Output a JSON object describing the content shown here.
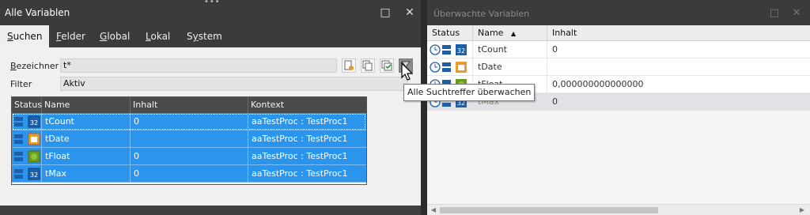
{
  "left_window": {
    "title": "Alle Variablen",
    "maximize_glyph": "□",
    "close_glyph": "✕",
    "grip_glyph": "•••",
    "tabs": [
      {
        "prefix": "",
        "accel": "S",
        "rest": "uchen"
      },
      {
        "prefix": "",
        "accel": "F",
        "rest": "elder"
      },
      {
        "prefix": "",
        "accel": "G",
        "rest": "lobal"
      },
      {
        "prefix": "",
        "accel": "L",
        "rest": "okal"
      },
      {
        "prefix": "S",
        "accel": "y",
        "rest": "stem"
      }
    ],
    "bezeichner_label": {
      "accel": "B",
      "rest": "ezeichner"
    },
    "bezeichner_value": "t*",
    "filter_label": "Filter",
    "filter_value": "Aktiv",
    "toolbar_icons": [
      "new-document-icon",
      "copy-icon",
      "check-all-icon",
      "watch-all-icon"
    ],
    "columns": [
      "Status",
      "Name",
      "Inhalt",
      "Kontext"
    ],
    "rows": [
      {
        "status": [
          "variable-icon",
          "int-type-icon"
        ],
        "name": "tCount",
        "inhalt": "0",
        "kontext": "aaTestProc : TestProc1"
      },
      {
        "status": [
          "variable-icon",
          "date-type-icon"
        ],
        "name": "tDate",
        "inhalt": "",
        "kontext": "aaTestProc : TestProc1"
      },
      {
        "status": [
          "variable-icon",
          "float-type-icon"
        ],
        "name": "tFloat",
        "inhalt": "0",
        "kontext": "aaTestProc : TestProc1"
      },
      {
        "status": [
          "variable-icon",
          "int-type-icon"
        ],
        "name": "tMax",
        "inhalt": "0",
        "kontext": "aaTestProc : TestProc1"
      }
    ]
  },
  "right_window": {
    "title": "Überwachte Variablen",
    "maximize_glyph": "□",
    "close_glyph": "✕",
    "columns": [
      "Status",
      "Name",
      "Inhalt"
    ],
    "sort_indicator": "▲",
    "rows": [
      {
        "name": "tCount",
        "inhalt": "0"
      },
      {
        "name": "tDate",
        "inhalt": ""
      },
      {
        "name": "tFloat",
        "inhalt": "0,000000000000000"
      },
      {
        "name": "tMax",
        "inhalt": "0"
      }
    ],
    "scroll_left_glyph": "◀",
    "scroll_right_glyph": "▶"
  },
  "tooltip": "Alle Suchtreffer überwachen",
  "colors": {
    "selection": "#2b95ee",
    "dark_chrome": "#3b3b3b",
    "panel": "#f0f0f0"
  }
}
